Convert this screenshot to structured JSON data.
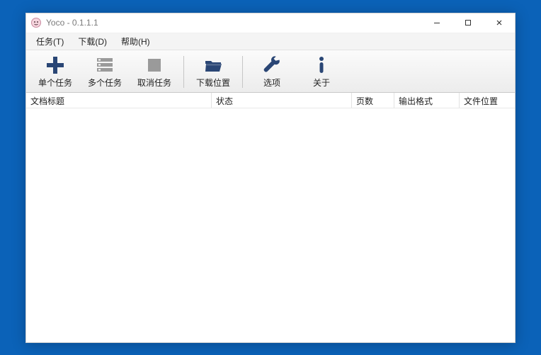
{
  "window": {
    "title": "Yoco - 0.1.1.1"
  },
  "menubar": {
    "items": [
      {
        "label": "任务(T)"
      },
      {
        "label": "下载(D)"
      },
      {
        "label": "帮助(H)"
      }
    ]
  },
  "toolbar": {
    "single_task": "单个任务",
    "multi_task": "多个任务",
    "cancel_task": "取消任务",
    "download_path": "下载位置",
    "options": "选项",
    "about": "关于"
  },
  "columns": {
    "title": "文档标题",
    "status": "状态",
    "pages": "页数",
    "format": "输出格式",
    "path": "文件位置"
  },
  "rows": []
}
